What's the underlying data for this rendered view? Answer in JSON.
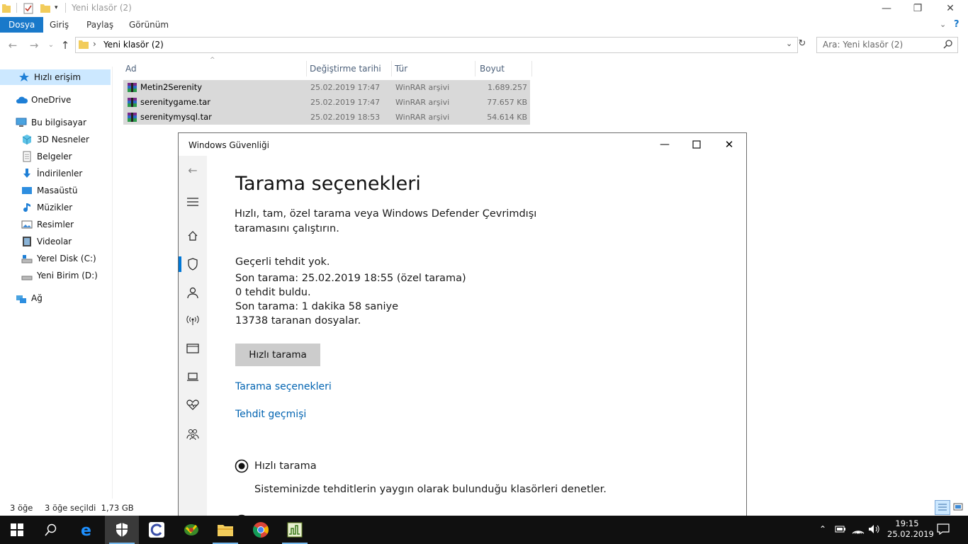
{
  "explorer": {
    "title": "Yeni klasör (2)",
    "ribbon_tabs": [
      "Dosya",
      "Giriş",
      "Paylaş",
      "Görünüm"
    ],
    "address_path": "Yeni klasör (2)",
    "search_placeholder": "Ara: Yeni klasör (2)",
    "sidebar": [
      {
        "label": "Hızlı erişim",
        "icon": "star-icon",
        "selected": true
      },
      {
        "label": "OneDrive",
        "icon": "cloud-icon"
      },
      {
        "label": "Bu bilgisayar",
        "icon": "computer-icon"
      },
      {
        "label": "3D Nesneler",
        "icon": "cube-icon"
      },
      {
        "label": "Belgeler",
        "icon": "document-icon"
      },
      {
        "label": "İndirilenler",
        "icon": "download-icon"
      },
      {
        "label": "Masaüstü",
        "icon": "desktop-icon"
      },
      {
        "label": "Müzikler",
        "icon": "music-icon"
      },
      {
        "label": "Resimler",
        "icon": "picture-icon"
      },
      {
        "label": "Videolar",
        "icon": "video-icon"
      },
      {
        "label": "Yerel Disk (C:)",
        "icon": "drive-icon"
      },
      {
        "label": "Yeni Birim (D:)",
        "icon": "drive-icon"
      },
      {
        "label": "Ağ",
        "icon": "network-icon"
      }
    ],
    "columns": [
      "Ad",
      "Değiştirme tarihi",
      "Tür",
      "Boyut"
    ],
    "files": [
      {
        "name": "Metin2Serenity",
        "date": "25.02.2019 17:47",
        "type": "WinRAR arşivi",
        "size": "1.689.257 KB"
      },
      {
        "name": "serenitygame.tar",
        "date": "25.02.2019 17:47",
        "type": "WinRAR arşivi",
        "size": "77.657 KB"
      },
      {
        "name": "serenitymysql.tar",
        "date": "25.02.2019 18:53",
        "type": "WinRAR arşivi",
        "size": "54.614 KB"
      }
    ],
    "status": {
      "count": "3 öğe",
      "selected": "3 öğe seçildi  1,73 GB"
    }
  },
  "defender": {
    "window_title": "Windows Güvenliği",
    "heading": "Tarama seçenekleri",
    "description": "Hızlı, tam, özel tarama veya Windows Defender Çevrimdışı taramasını çalıştırın.",
    "status_lines": [
      "Geçerli tehdit yok.",
      "Son tarama: 25.02.2019 18:55 (özel tarama)",
      "0 tehdit buldu.",
      "Son tarama: 1 dakika 58 saniye",
      "13738 taranan dosyalar."
    ],
    "quick_scan_button": "Hızlı tarama",
    "links": [
      "Tarama seçenekleri",
      "Tehdit geçmişi"
    ],
    "radio_option": {
      "label": "Hızlı tarama",
      "checked": true,
      "description": "Sisteminizde tehditlerin yaygın olarak bulunduğu klasörleri denetler."
    },
    "accent": "#0078d7"
  },
  "taskbar": {
    "time": "19:15",
    "date": "25.02.2019"
  }
}
